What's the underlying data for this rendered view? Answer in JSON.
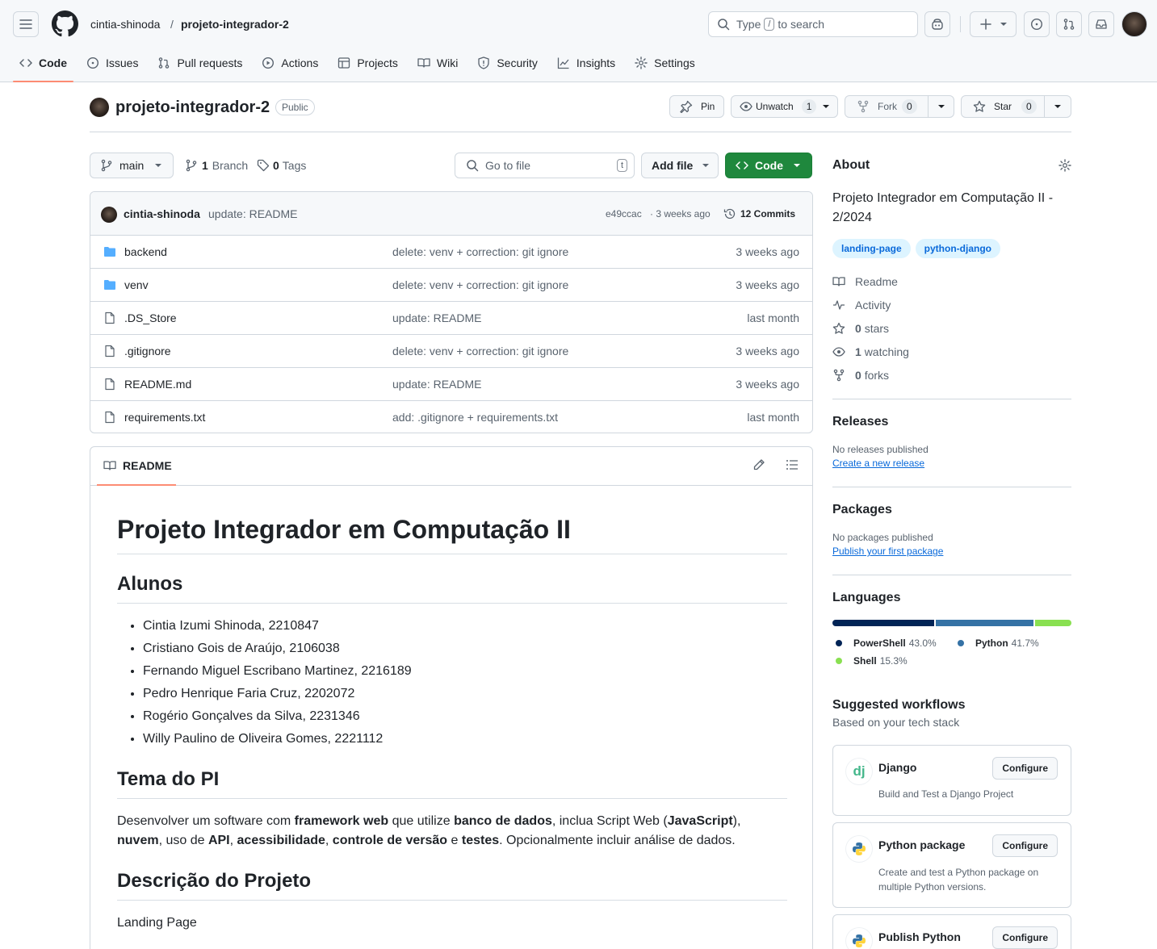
{
  "header": {
    "owner": "cintia-shinoda",
    "separator": "/",
    "repo": "projeto-integrador-2",
    "search_prefix": "Type",
    "search_key": "/",
    "search_suffix": "to search"
  },
  "tabs": [
    {
      "label": "Code"
    },
    {
      "label": "Issues"
    },
    {
      "label": "Pull requests"
    },
    {
      "label": "Actions"
    },
    {
      "label": "Projects"
    },
    {
      "label": "Wiki"
    },
    {
      "label": "Security"
    },
    {
      "label": "Insights"
    },
    {
      "label": "Settings"
    }
  ],
  "repo": {
    "name": "projeto-integrador-2",
    "visibility": "Public",
    "pin": "Pin",
    "unwatch": "Unwatch",
    "watch_count": "1",
    "fork": "Fork",
    "fork_count": "0",
    "star": "Star",
    "star_count": "0"
  },
  "toolbar": {
    "branch": "main",
    "branches_n": "1",
    "branches_label": "Branch",
    "tags_n": "0",
    "tags_label": "Tags",
    "goto": "Go to file",
    "goto_key": "t",
    "add_file": "Add file",
    "code": "Code"
  },
  "commit": {
    "author": "cintia-shinoda",
    "message": "update: README",
    "hash": "e49ccac",
    "when": "· 3 weeks ago",
    "commits": "12 Commits"
  },
  "files": [
    {
      "name": "backend",
      "message": "delete: venv + correction: git ignore",
      "date": "3 weeks ago",
      "type": "folder"
    },
    {
      "name": "venv",
      "message": "delete: venv + correction: git ignore",
      "date": "3 weeks ago",
      "type": "folder"
    },
    {
      "name": ".DS_Store",
      "message": "update: README",
      "date": "last month",
      "type": "file"
    },
    {
      "name": ".gitignore",
      "message": "delete: venv + correction: git ignore",
      "date": "3 weeks ago",
      "type": "file"
    },
    {
      "name": "README.md",
      "message": "update: README",
      "date": "3 weeks ago",
      "type": "file"
    },
    {
      "name": "requirements.txt",
      "message": "add: .gitignore + requirements.txt",
      "date": "last month",
      "type": "file"
    }
  ],
  "readme": {
    "tab": "README",
    "h1": "Projeto Integrador em Computação II",
    "h2_alunos": "Alunos",
    "alunos": [
      "Cintia Izumi Shinoda, 2210847",
      "Cristiano Gois de Araújo, 2106038",
      "Fernando Miguel Escribano Martinez, 2216189",
      "Pedro Henrique Faria Cruz, 2202072",
      "Rogério Gonçalves da Silva, 2231346",
      "Willy Paulino de Oliveira Gomes, 2221112"
    ],
    "h2_tema": "Tema do PI",
    "tema": {
      "t1": "Desenvolver um software com ",
      "b1": "framework web",
      "t2": " que utilize ",
      "b2": "banco de dados",
      "t3": ", inclua Script Web (",
      "b3": "JavaScript",
      "t4": "),",
      "b4": "nuvem",
      "t5": ", uso de ",
      "b5": "API",
      "t6": ", ",
      "b6": "acessibilidade",
      "t7": ", ",
      "b7": "controle de versão",
      "t8": " e ",
      "b8": "testes",
      "t9": ". Opcionalmente incluir análise de dados."
    },
    "h2_desc": "Descrição do Projeto",
    "desc": "Landing Page"
  },
  "about": {
    "title": "About",
    "description": "Projeto Integrador em Computação II - 2/2024",
    "topics": [
      "landing-page",
      "python-django"
    ],
    "readme": "Readme",
    "activity": "Activity",
    "stars_n": "0",
    "stars": "stars",
    "watching_n": "1",
    "watching": "watching",
    "forks_n": "0",
    "forks": "forks"
  },
  "releases": {
    "title": "Releases",
    "none": "No releases published",
    "link": "Create a new release"
  },
  "packages": {
    "title": "Packages",
    "none": "No packages published",
    "link": "Publish your first package"
  },
  "languages": {
    "title": "Languages",
    "items": [
      {
        "name": "PowerShell",
        "pct": "43.0%",
        "value": 43.0,
        "color": "#012456"
      },
      {
        "name": "Python",
        "pct": "41.7%",
        "value": 41.7,
        "color": "#3572A5"
      },
      {
        "name": "Shell",
        "pct": "15.3%",
        "value": 15.3,
        "color": "#89e051"
      }
    ]
  },
  "workflows": {
    "title": "Suggested workflows",
    "subtitle": "Based on your tech stack",
    "items": [
      {
        "name": "Django",
        "desc": "Build and Test a Django Project",
        "btn": "Configure",
        "icon_text": "dj"
      },
      {
        "name": "Python package",
        "desc": "Create and test a Python package on multiple Python versions.",
        "btn": "Configure"
      },
      {
        "name": "Publish Python",
        "desc": "",
        "btn": "Configure"
      }
    ]
  }
}
